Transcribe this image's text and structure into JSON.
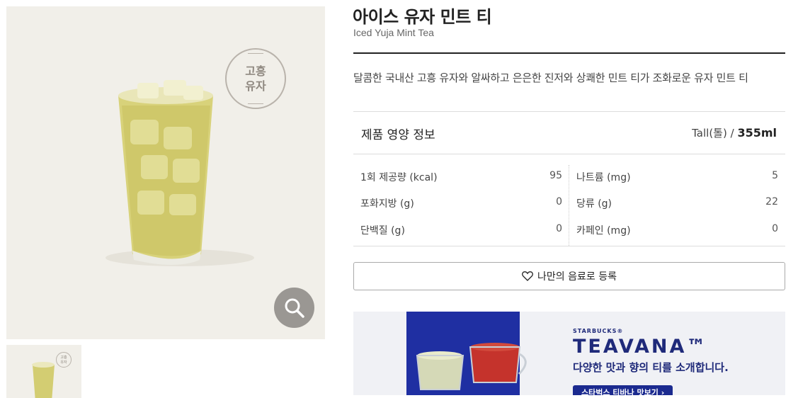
{
  "product": {
    "name_ko": "아이스 유자 민트 티",
    "name_en": "Iced Yuja Mint Tea",
    "badge_line1": "고흥",
    "badge_line2": "유자",
    "description": "달콤한 국내산 고흥 유자와 알싸하고 은은한 진저와 상쾌한 민트 티가 조화로운 유자 민트 티"
  },
  "nutrition": {
    "title": "제품 영양 정보",
    "size_label": "Tall(톨) /",
    "size_value": "355ml",
    "left": [
      {
        "label": "1회 제공량 (kcal)",
        "value": "95"
      },
      {
        "label": "포화지방 (g)",
        "value": "0"
      },
      {
        "label": "단백질 (g)",
        "value": "0"
      }
    ],
    "right": [
      {
        "label": "나트륨 (mg)",
        "value": "5"
      },
      {
        "label": "당류 (g)",
        "value": "22"
      },
      {
        "label": "카페인 (mg)",
        "value": "0"
      }
    ]
  },
  "actions": {
    "favorite_label": "나만의 음료로 등록"
  },
  "banner": {
    "sub": "STARBUCKS®",
    "brand": "TEAVANA™",
    "copy": "다양한 맛과 향의 티를 소개합니다.",
    "cta": "스타벅스 티바나 맛보기  ›"
  },
  "icons": {
    "zoom": "magnifier-icon",
    "heart": "heart-icon"
  },
  "colors": {
    "image_bg": "#f1efe9",
    "zoom_bg": "#9a9793",
    "teavana_blue": "#1f2a7a"
  }
}
